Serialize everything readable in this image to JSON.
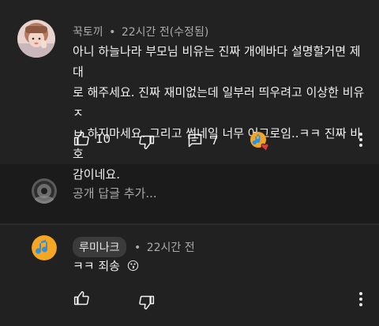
{
  "comment": {
    "author": "꾹토끼",
    "separator": "•",
    "time": "22시간 전(수정됨)",
    "text_lines": [
      "아니 하늘나라 부모님 비유는 진짜 개에바다 설명할거면 제대",
      "로 해주세요. 진짜 재미없는데 일부러 띄우려고 이상한 비유 ㅈ",
      "ㅂ 하지마세요. 그리고 썸네일 너무 어그로임..ㅋㅋ 진짜 비호",
      "감이네요."
    ],
    "like_count": "10",
    "reply_count": "7",
    "icons": {
      "like": "thumbs-up-icon",
      "dislike": "thumbs-down-icon",
      "replies": "comment-icon",
      "creator_heart": "creator-heart-icon",
      "menu": "more-vert-icon"
    }
  },
  "reply_box": {
    "placeholder": "공개 답글 추가..."
  },
  "reply": {
    "author": "루미나크",
    "separator": "•",
    "time": "22시간 전",
    "text": "ㅋㅋ 죄송",
    "emoji": "😗"
  },
  "colors": {
    "background_top": "#222222",
    "background_mid": "#1b1b1b",
    "background_bottom": "#212121",
    "text_primary": "#f1f1f1",
    "text_secondary": "#aaaaaa",
    "heart": "#e53935",
    "music_note": "#2f8fe0",
    "music_bg": "#f5a623"
  }
}
